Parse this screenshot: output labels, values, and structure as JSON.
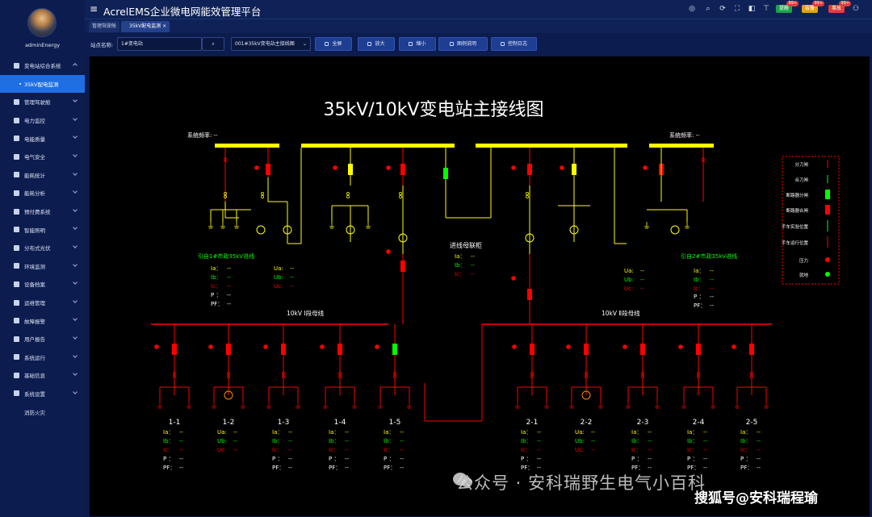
{
  "user": {
    "name": "adminEnergy"
  },
  "header": {
    "title": "AcrelEMS企业微电网能效管理平台",
    "badges": [
      {
        "label": "提醒",
        "count": "99+",
        "color": "#1aa34a"
      },
      {
        "label": "告警",
        "count": "99+",
        "color": "#e0a412"
      },
      {
        "label": "事故",
        "count": "99+",
        "color": "#e23c3c"
      }
    ]
  },
  "sidebar": {
    "items": [
      {
        "label": "变电站综合系统",
        "expanded": true,
        "active": false,
        "icon": "home-icon"
      },
      {
        "label": "35kV配电监测",
        "active": true,
        "sub": true
      },
      {
        "label": "管理驾驶舱",
        "icon": "dashboard-icon"
      },
      {
        "label": "电力监控",
        "icon": "power-icon"
      },
      {
        "label": "电能质量",
        "icon": "quality-icon"
      },
      {
        "label": "电气安全",
        "icon": "safety-icon"
      },
      {
        "label": "能耗统计",
        "icon": "stats-icon"
      },
      {
        "label": "能耗分析",
        "icon": "analysis-icon"
      },
      {
        "label": "预付费系统",
        "icon": "prepay-icon"
      },
      {
        "label": "智能照明",
        "icon": "light-icon"
      },
      {
        "label": "分布式光伏",
        "icon": "pv-icon"
      },
      {
        "label": "环境监测",
        "icon": "env-icon"
      },
      {
        "label": "设备档案",
        "icon": "device-icon"
      },
      {
        "label": "运维管理",
        "icon": "ops-icon"
      },
      {
        "label": "故障报警",
        "icon": "alarm-icon"
      },
      {
        "label": "用户报告",
        "icon": "report-icon"
      },
      {
        "label": "系统运行",
        "icon": "run-icon"
      },
      {
        "label": "基础信息",
        "icon": "info-icon"
      },
      {
        "label": "系统设置",
        "icon": "settings-icon"
      },
      {
        "label": "消防火灾",
        "noicon": true
      }
    ]
  },
  "tabs": [
    {
      "label": "管理驾驶舱"
    },
    {
      "label": "35kV配电监测"
    }
  ],
  "toolbar": {
    "station_label": "站点名称:",
    "station_value": "1#变电站",
    "diagram_select": "001#35kV变电站主接线图",
    "buttons": [
      "全屏",
      "放大",
      "缩小",
      "图例说明",
      "控制日志"
    ]
  },
  "diagram": {
    "title": "35kV/10kV变电站主接线图",
    "freq_left": "系统频率: --",
    "freq_right": "系统频率: --",
    "incoming_left": "引自1#市政35kV进线",
    "incoming_right": "引自2#市政35kV进线",
    "bus_tie": "进线母联柜",
    "bus10_left": "10kV Ⅰ段母线",
    "bus10_right": "10kV Ⅱ段母线",
    "feeders": [
      "1-1",
      "1-2",
      "1-3",
      "1-4",
      "1-5",
      "2-1",
      "2-2",
      "2-3",
      "2-4",
      "2-5"
    ],
    "legend": [
      "分刀闸",
      "合刀闸",
      "断路器分闸",
      "断路器合闸",
      "手车实验位置",
      "手车运行位置",
      "压力",
      "就地"
    ],
    "measure_labels_i": [
      "Ia：",
      "Ib：",
      "Ic："
    ],
    "measure_labels_u": [
      "Ua:",
      "Ub:",
      "Uc:"
    ],
    "measure_labels_p": [
      "P ：",
      "PF："
    ],
    "dash": "--"
  },
  "watermark": {
    "line1": "公众号 · 安科瑞野生电气小百科",
    "line2": "搜狐号@安科瑞程瑜"
  },
  "colors": {
    "bus": "#ffff00",
    "closed": "#ff0000",
    "open": "#00ff00",
    "line_red": "#ff0000",
    "line_yellow": "#ffff00"
  }
}
